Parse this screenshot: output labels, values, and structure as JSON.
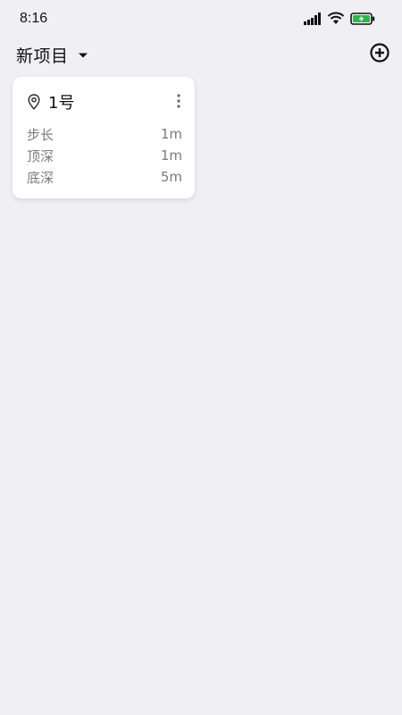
{
  "status_bar": {
    "time": "8:16",
    "signal_icon": "cellular-signal-icon",
    "wifi_icon": "wifi-icon",
    "battery_icon": "battery-charging-icon",
    "battery_color": "#2fb54a"
  },
  "header": {
    "project_title": "新项目",
    "dropdown_icon": "caret-down-icon",
    "add_icon": "add-circle-icon"
  },
  "cards": [
    {
      "icon": "location-pin-icon",
      "title": "1号",
      "menu_icon": "more-vertical-icon",
      "rows": [
        {
          "label": "步长",
          "value": "1m"
        },
        {
          "label": "顶深",
          "value": "1m"
        },
        {
          "label": "底深",
          "value": "5m"
        }
      ]
    }
  ],
  "colors": {
    "background": "#efeff4",
    "card": "#ffffff",
    "secondary_text": "#7a7a7f"
  }
}
